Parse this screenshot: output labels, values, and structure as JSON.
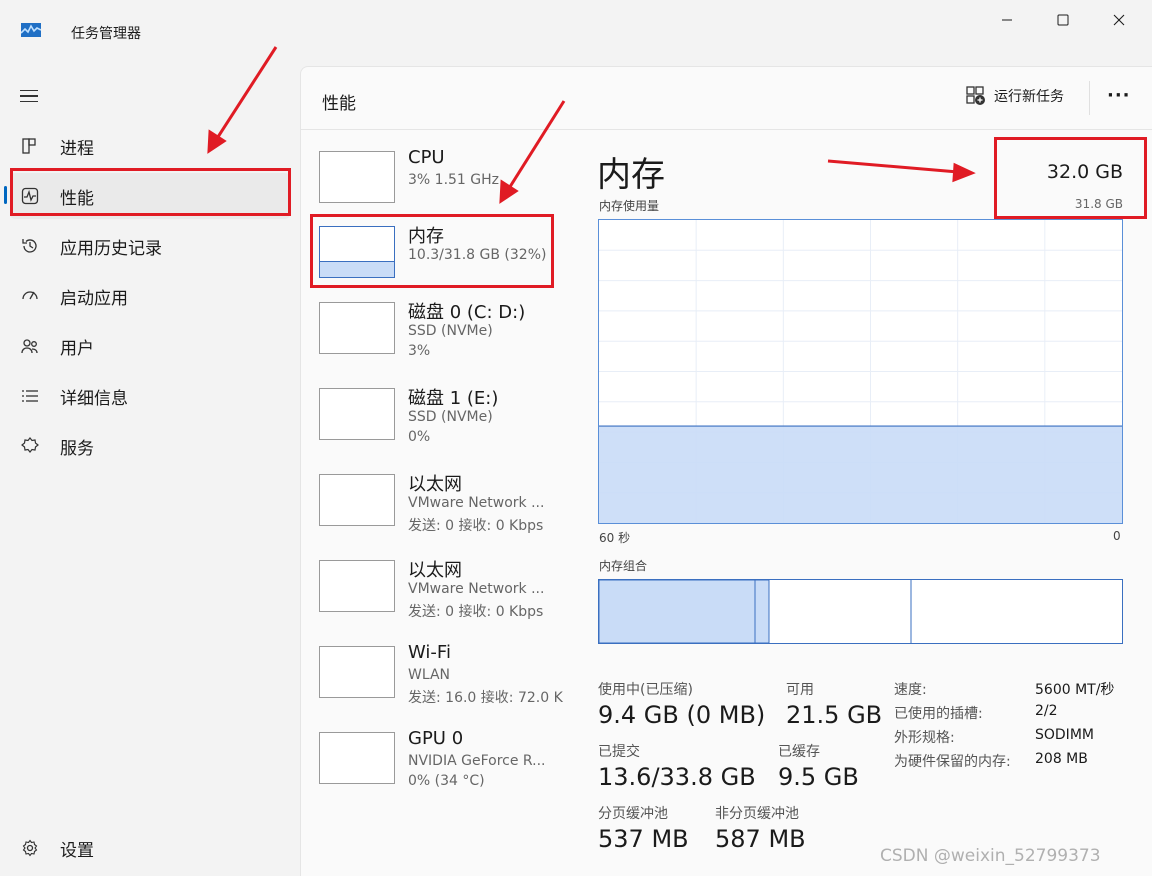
{
  "window": {
    "title": "任务管理器"
  },
  "sidebar": {
    "items": [
      {
        "label": "进程",
        "icon": "processes-icon"
      },
      {
        "label": "性能",
        "icon": "performance-icon",
        "active": true
      },
      {
        "label": "应用历史记录",
        "icon": "app-history-icon"
      },
      {
        "label": "启动应用",
        "icon": "startup-icon"
      },
      {
        "label": "用户",
        "icon": "users-icon"
      },
      {
        "label": "详细信息",
        "icon": "details-icon"
      },
      {
        "label": "服务",
        "icon": "services-icon"
      }
    ],
    "settings": "设置"
  },
  "header": {
    "title": "性能",
    "run_task": "运行新任务"
  },
  "devices": [
    {
      "name": "CPU",
      "lines": [
        "3% 1.51 GHz"
      ]
    },
    {
      "name": "内存",
      "lines": [
        "10.3/31.8 GB (32%)"
      ],
      "selected": true
    },
    {
      "name": "磁盘 0 (C: D:)",
      "lines": [
        "SSD (NVMe)",
        "3%"
      ]
    },
    {
      "name": "磁盘 1 (E:)",
      "lines": [
        "SSD (NVMe)",
        "0%"
      ]
    },
    {
      "name": "以太网",
      "lines": [
        "VMware Network ...",
        "发送: 0 接收: 0 Kbps"
      ]
    },
    {
      "name": "以太网",
      "lines": [
        "VMware Network ...",
        "发送: 0 接收: 0 Kbps"
      ]
    },
    {
      "name": "Wi-Fi",
      "lines": [
        "WLAN",
        "发送: 16.0 接收: 72.0 K"
      ]
    },
    {
      "name": "GPU 0",
      "lines": [
        "NVIDIA GeForce R...",
        "0% (34 °C)"
      ]
    }
  ],
  "detail": {
    "title": "内存",
    "total": "32.0 GB",
    "total_sub": "31.8 GB",
    "usage_label": "内存使用量",
    "axis_left": "60 秒",
    "axis_right": "0",
    "composition_label": "内存组合",
    "usage_fraction": 0.32,
    "stats": [
      {
        "label": "使用中(已压缩)",
        "value": "9.4 GB (0 MB)"
      },
      {
        "label": "可用",
        "value": "21.5 GB"
      },
      {
        "label": "已提交",
        "value": "13.6/33.8 GB"
      },
      {
        "label": "已缓存",
        "value": "9.5 GB"
      },
      {
        "label": "分页缓冲池",
        "value": "537 MB"
      },
      {
        "label": "非分页缓冲池",
        "value": "587 MB"
      }
    ],
    "specs": [
      {
        "label": "速度:",
        "value": "5600 MT/秒"
      },
      {
        "label": "已使用的插槽:",
        "value": "2/2"
      },
      {
        "label": "外形规格:",
        "value": "SODIMM"
      },
      {
        "label": "为硬件保留的内存:",
        "value": "208 MB"
      }
    ]
  },
  "watermark": "CSDN @weixin_52799373",
  "colors": {
    "accent": "#0067c0",
    "memory_fill": "#c9dcf7",
    "memory_line": "#3a6fc0",
    "annotation": "#e01b24"
  }
}
